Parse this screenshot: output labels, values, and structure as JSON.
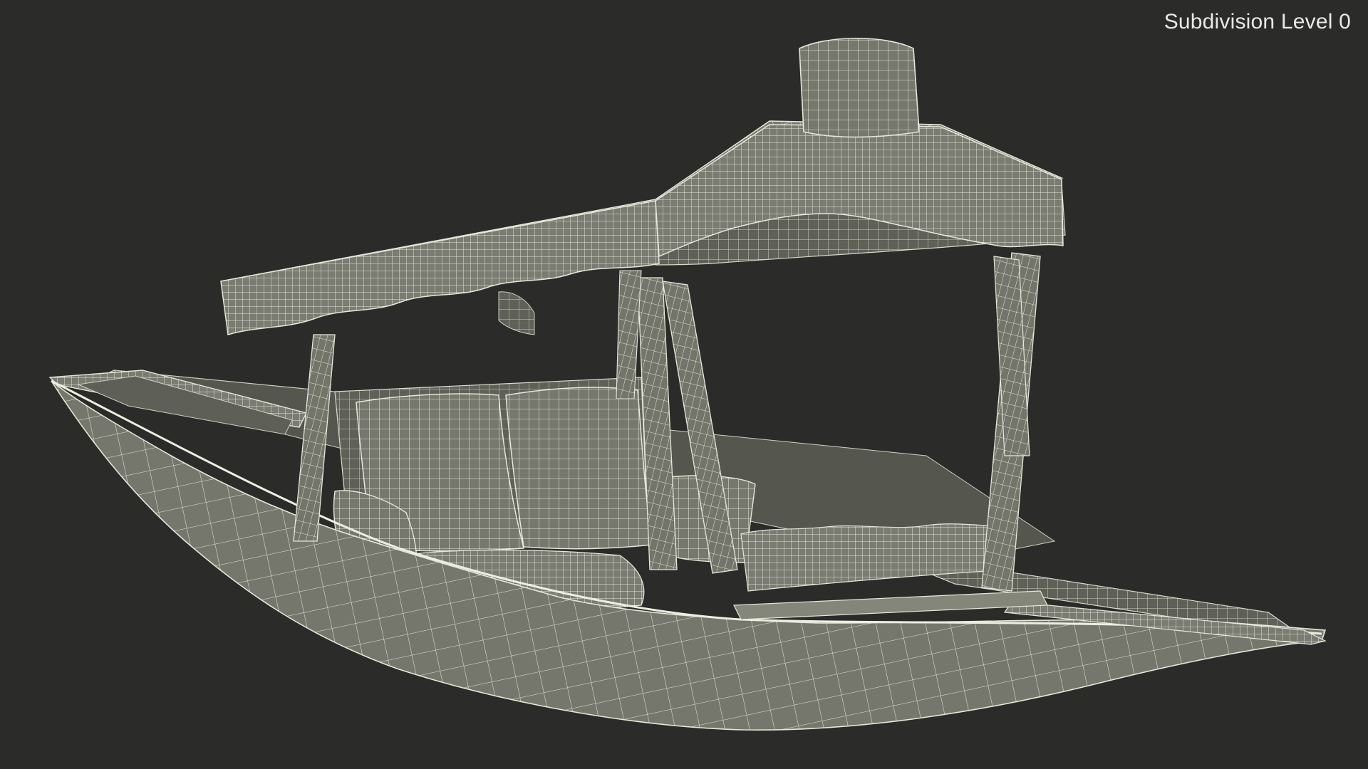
{
  "overlay": {
    "caption": "Subdivision Level 0"
  },
  "scene": {
    "subject": "shikara-boat-wireframe",
    "background_color": "#2b2b2a",
    "mesh_fill_color": "#77786d",
    "mesh_shadow_color": "#5e5f56",
    "wire_color": "#e6e6da"
  }
}
